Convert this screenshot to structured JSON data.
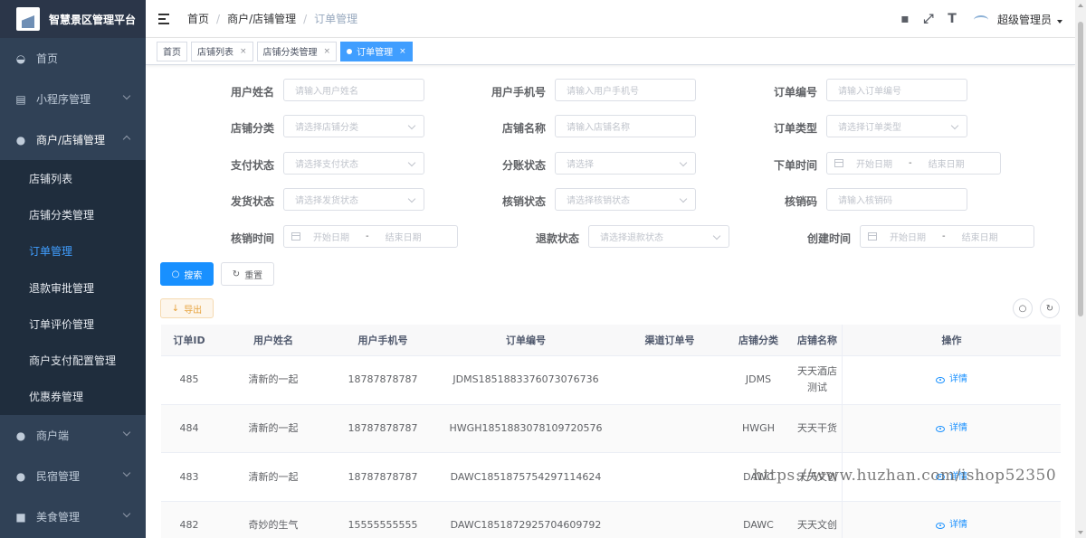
{
  "app": {
    "title": "智慧景区管理平台"
  },
  "sidebar": {
    "items": [
      {
        "label": "首页",
        "icon": "dashboard-icon"
      },
      {
        "label": "小程序管理",
        "icon": "table-icon"
      },
      {
        "label": "商户/店铺管理",
        "icon": "user-icon"
      }
    ],
    "sub_items": [
      {
        "label": "店铺列表"
      },
      {
        "label": "店铺分类管理"
      },
      {
        "label": "订单管理",
        "active": true
      },
      {
        "label": "退款审批管理"
      },
      {
        "label": "订单评价管理"
      },
      {
        "label": "商户支付配置管理"
      },
      {
        "label": "优惠券管理"
      }
    ],
    "bottom_items": [
      {
        "label": "商户端",
        "icon": "peoples-icon"
      },
      {
        "label": "民宿管理",
        "icon": "peoples-icon"
      },
      {
        "label": "美食管理",
        "icon": "form-icon"
      }
    ]
  },
  "navbar": {
    "breadcrumb": [
      "首页",
      "商户/店铺管理",
      "订单管理"
    ],
    "username": "超级管理员",
    "icons": [
      "message-icon",
      "fullscreen-icon",
      "font-size-icon"
    ]
  },
  "tags": [
    {
      "label": "首页"
    },
    {
      "label": "店铺列表"
    },
    {
      "label": "店铺分类管理"
    },
    {
      "label": "订单管理",
      "active": true
    }
  ],
  "filters": {
    "user_name": {
      "label": "用户姓名",
      "placeholder": "请输入用户姓名"
    },
    "user_phone": {
      "label": "用户手机号",
      "placeholder": "请输入用户手机号"
    },
    "order_no": {
      "label": "订单编号",
      "placeholder": "请输入订单编号"
    },
    "shop_category": {
      "label": "店铺分类",
      "placeholder": "请选择店铺分类"
    },
    "shop_name": {
      "label": "店铺名称",
      "placeholder": "请输入店铺名称"
    },
    "order_type": {
      "label": "订单类型",
      "placeholder": "请选择订单类型"
    },
    "pay_status": {
      "label": "支付状态",
      "placeholder": "请选择支付状态"
    },
    "split_status": {
      "label": "分账状态",
      "placeholder": "请选择"
    },
    "order_time": {
      "label": "下单时间",
      "start": "开始日期",
      "sep": "-",
      "end": "结束日期"
    },
    "ship_status": {
      "label": "发货状态",
      "placeholder": "请选择发货状态"
    },
    "verify_status": {
      "label": "核销状态",
      "placeholder": "请选择核销状态"
    },
    "verify_code": {
      "label": "核销码",
      "placeholder": "请输入核销码"
    },
    "verify_time": {
      "label": "核销时间",
      "start": "开始日期",
      "sep": "-",
      "end": "结束日期"
    },
    "refund_status": {
      "label": "退款状态",
      "placeholder": "请选择退款状态"
    },
    "create_time": {
      "label": "创建时间",
      "start": "开始日期",
      "sep": "-",
      "end": "结束日期"
    }
  },
  "actions": {
    "search": "搜索",
    "reset": "重置",
    "export": "导出"
  },
  "table": {
    "columns": [
      "订单ID",
      "用户姓名",
      "用户手机号",
      "订单编号",
      "渠道订单号",
      "店铺分类",
      "店铺名称",
      "操作"
    ],
    "rows": [
      {
        "id": "485",
        "name": "清新的一起",
        "phone": "18787878787",
        "order_no": "JDMS1851883376073076736",
        "channel_no": "",
        "category": "JDMS",
        "shop": "天天酒店测试",
        "action": "详情"
      },
      {
        "id": "484",
        "name": "清新的一起",
        "phone": "18787878787",
        "order_no": "HWGH1851883078109720576",
        "channel_no": "",
        "category": "HWGH",
        "shop": "天天干货",
        "action": "详情"
      },
      {
        "id": "483",
        "name": "清新的一起",
        "phone": "18787878787",
        "order_no": "DAWC1851875754297114624",
        "channel_no": "",
        "category": "DAWC",
        "shop": "天天文创",
        "action": "详情"
      },
      {
        "id": "482",
        "name": "奇妙的生气",
        "phone": "15555555555",
        "order_no": "DAWC1851872925704609792",
        "channel_no": "",
        "category": "DAWC",
        "shop": "天天文创",
        "action": "详情"
      }
    ]
  },
  "watermark": "https://www.huzhan.com/ishop52350"
}
